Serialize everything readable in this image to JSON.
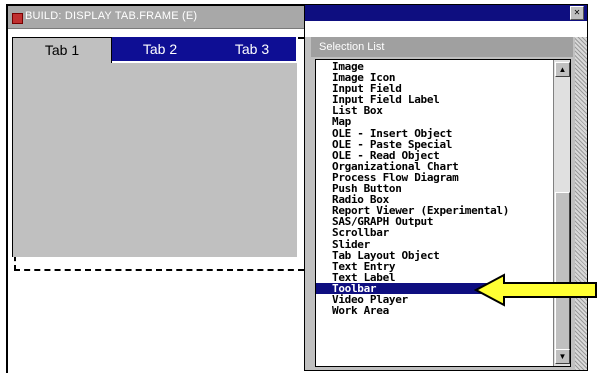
{
  "build_window": {
    "title": "BUILD: DISPLAY TAB.FRAME (E)",
    "tabs": [
      {
        "label": "Tab 1",
        "active": true
      },
      {
        "label": "Tab 2",
        "active": false
      },
      {
        "label": "Tab 3",
        "active": false
      }
    ]
  },
  "selection_window": {
    "title": "Selection List",
    "close_icon": "close-icon",
    "items": [
      "Image",
      "Image Icon",
      "Input Field",
      "Input Field Label",
      "List Box",
      "Map",
      "OLE - Insert Object",
      "OLE - Paste Special",
      "OLE - Read Object",
      "Organizational Chart",
      "Process Flow Diagram",
      "Push Button",
      "Radio Box",
      "Report Viewer (Experimental)",
      "SAS/GRAPH Output",
      "Scrollbar",
      "Slider",
      "Tab Layout Object",
      "Text Entry",
      "Text Label",
      "Toolbar",
      "Video Player",
      "Work Area"
    ],
    "selected_item": "Toolbar",
    "highlighted_item": "Tab Layout Object"
  },
  "colors": {
    "tab_active_bg": "#c0c0c0",
    "tab_inactive_bg": "#0e0e94",
    "selection_bg": "#0e0e80",
    "arrow_fill": "#ffff33"
  }
}
